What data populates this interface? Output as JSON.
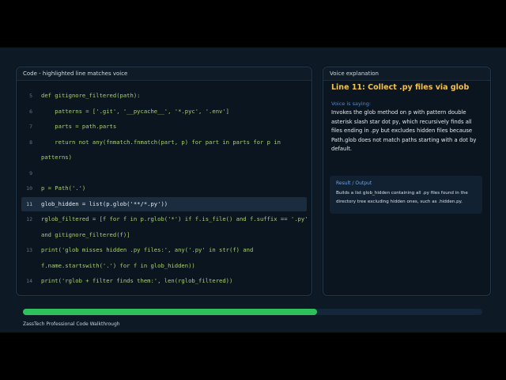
{
  "code_panel": {
    "header": "Code - highlighted line matches voice",
    "highlight_line": "11",
    "lines": [
      {
        "num": "5",
        "text": "def gitignore_filtered(path):"
      },
      {
        "num": "6",
        "text": "    patterns = ['.git', '__pycache__', '*.pyc', '.env']"
      },
      {
        "num": "7",
        "text": "    parts = path.parts"
      },
      {
        "num": "8",
        "text": "    return not any(fnmatch.fnmatch(part, p) for part in parts for p in"
      },
      {
        "num": "",
        "text": "patterns)"
      },
      {
        "num": "9",
        "text": ""
      },
      {
        "num": "10",
        "text": "p = Path('.')"
      },
      {
        "num": "11",
        "text": "glob_hidden = list(p.glob('**/*.py'))"
      },
      {
        "num": "12",
        "text": "rglob_filtered = [f for f in p.rglob('*') if f.is_file() and f.suffix == '.py'"
      },
      {
        "num": "",
        "text": "and gitignore_filtered(f)]"
      },
      {
        "num": "13",
        "text": "print('glob misses hidden .py files:', any('.py' in str(f) and"
      },
      {
        "num": "",
        "text": "f.name.startswith('.') for f in glob_hidden))"
      },
      {
        "num": "14",
        "text": "print('rglob + filter finds them:', len(rglob_filtered))"
      }
    ]
  },
  "voice_panel": {
    "header": "Voice explanation",
    "title": "Line 11: Collect .py files via glob",
    "saying_label": "Voice is saying:",
    "saying_text": "Invokes the glob method on p with pattern double asterisk slash star dot py, which recursively finds all files ending in .py but excludes hidden files because Path.glob does not match paths starting with a dot by default.",
    "result_label": "Result / Output",
    "result_text": "Builds a list glob_hidden containing all .py files found in the directory tree excluding hidden ones, such as .hidden.py."
  },
  "progress": {
    "fraction": 0.64
  },
  "footer": {
    "text": "ZassTech Professional Code Walkthrough"
  },
  "colors": {
    "accent_title": "#f2c14e",
    "progress": "#2ec05a",
    "code": "#a9cf6e"
  }
}
